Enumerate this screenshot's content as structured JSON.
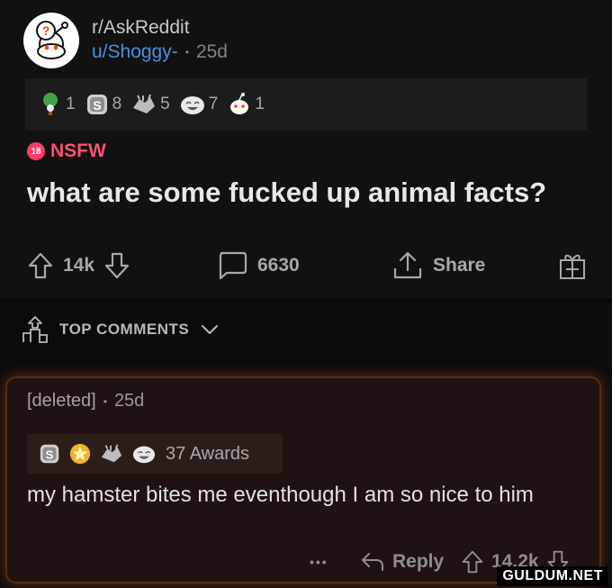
{
  "post": {
    "subreddit": "r/AskReddit",
    "username": "u/Shoggy-",
    "separator": "•",
    "age": "25d",
    "awards": [
      {
        "icon": "tree-hugger-award-icon",
        "count": "1"
      },
      {
        "icon": "silver-award-icon",
        "count": "8"
      },
      {
        "icon": "wholesome-award-icon",
        "count": "5"
      },
      {
        "icon": "laughing-award-icon",
        "count": "7"
      },
      {
        "icon": "snoo-award-icon",
        "count": "1"
      }
    ],
    "nsfw_badge": "18",
    "nsfw_label": "NSFW",
    "title": "what are some fucked up animal facts?",
    "score": "14k",
    "comments": "6630",
    "share_label": "Share"
  },
  "sort": {
    "label": "TOP COMMENTS"
  },
  "comment": {
    "author": "[deleted]",
    "separator": "•",
    "age": "25d",
    "awards_label": "37 Awards",
    "body": "my hamster bites me eventhough I am so nice to him",
    "more": "•••",
    "reply_label": "Reply",
    "score": "14.2k"
  },
  "watermark": "GULDUM.NET",
  "colors": {
    "background": "#0b0b0b",
    "post_bg": "#111111",
    "username": "#4a8fdb",
    "nsfw": "#ff4f73",
    "comment_glow": "#dc5a28"
  }
}
